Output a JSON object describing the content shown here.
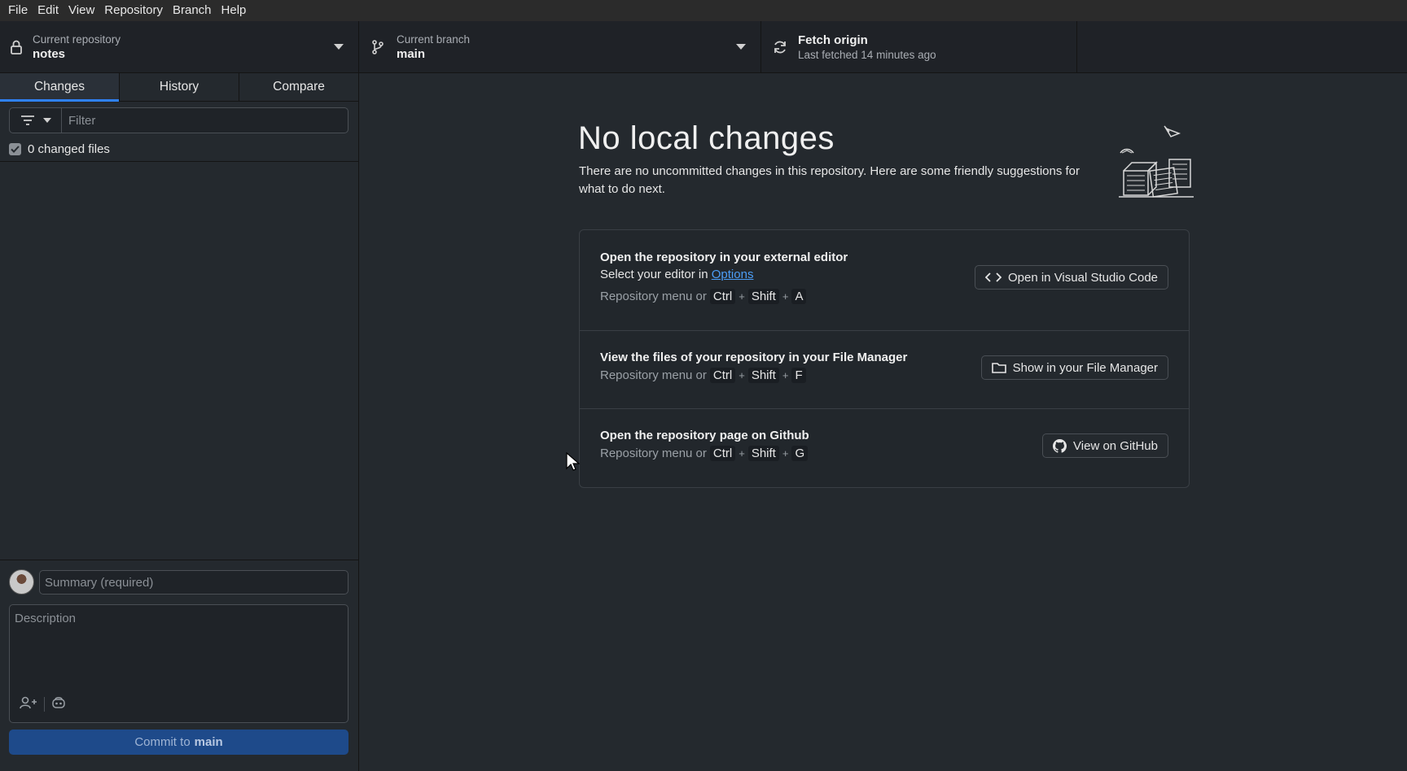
{
  "menu": [
    "File",
    "Edit",
    "View",
    "Repository",
    "Branch",
    "Help"
  ],
  "toolbar": {
    "repo": {
      "label": "Current repository",
      "value": "notes",
      "icon": "lock-icon"
    },
    "branch": {
      "label": "Current branch",
      "value": "main",
      "icon": "git-branch-icon"
    },
    "fetch": {
      "label": "Fetch origin",
      "sub": "Last fetched 14 minutes ago",
      "icon": "sync-icon"
    }
  },
  "sidebar": {
    "tabs": [
      {
        "label": "Changes",
        "active": true
      },
      {
        "label": "History",
        "active": false
      },
      {
        "label": "Compare",
        "active": false
      }
    ],
    "filter_placeholder": "Filter",
    "changed_files": "0 changed files",
    "commit": {
      "summary_placeholder": "Summary (required)",
      "description_placeholder": "Description",
      "button_prefix": "Commit to",
      "button_branch": "main"
    }
  },
  "main": {
    "title": "No local changes",
    "subtitle": "There are no uncommitted changes in this repository. Here are some friendly suggestions for what to do next.",
    "cards": {
      "editor": {
        "title": "Open the repository in your external editor",
        "line_prefix": "Select your editor in",
        "line_link": "Options",
        "shortcut_prefix": "Repository menu or",
        "keys": [
          "Ctrl",
          "Shift",
          "A"
        ],
        "button": "Open in Visual Studio Code"
      },
      "files": {
        "title": "View the files of your repository in your File Manager",
        "shortcut_prefix": "Repository menu or",
        "keys": [
          "Ctrl",
          "Shift",
          "F"
        ],
        "button": "Show in your File Manager"
      },
      "github": {
        "title": "Open the repository page on Github",
        "shortcut_prefix": "Repository menu or",
        "keys": [
          "Ctrl",
          "Shift",
          "G"
        ],
        "button": "View on GitHub"
      }
    }
  },
  "colors": {
    "accent": "#2f81f7",
    "background": "#24292e",
    "link": "#4c9df5"
  }
}
